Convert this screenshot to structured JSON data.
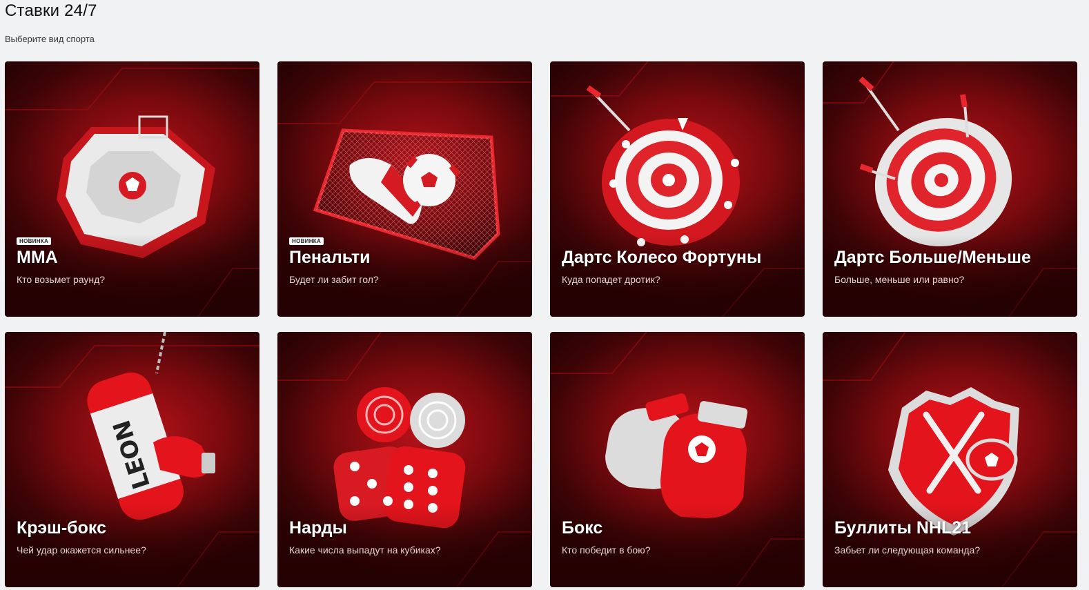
{
  "header": {
    "title": "Ставки 24/7",
    "subtitle": "Выберите вид спорта"
  },
  "colors": {
    "accent": "#e3141c",
    "card_dark": "#2a0204",
    "card_mid": "#7a0a0e",
    "page_bg": "#f1f2f4"
  },
  "cards": [
    {
      "title": "MMA",
      "subtitle": "Кто возьмет раунд?",
      "badge": "НОВИНКА",
      "icon": "octagon-cage-icon"
    },
    {
      "title": "Пенальти",
      "subtitle": "Будет ли забит гол?",
      "badge": "НОВИНКА",
      "icon": "football-goal-icon"
    },
    {
      "title": "Дартс Колесо Фортуны",
      "subtitle": "Куда попадет дротик?",
      "badge": "",
      "icon": "dart-wheel-icon"
    },
    {
      "title": "Дартс Больше/Меньше",
      "subtitle": "Больше, меньше или равно?",
      "badge": "",
      "icon": "dartboard-icon"
    },
    {
      "title": "Крэш-бокс",
      "subtitle": "Чей удар окажется сильнее?",
      "badge": "",
      "icon": "punching-bag-icon"
    },
    {
      "title": "Нарды",
      "subtitle": "Какие числа выпадут на кубиках?",
      "badge": "",
      "icon": "dice-icon"
    },
    {
      "title": "Бокс",
      "subtitle": "Кто победит в бою?",
      "badge": "",
      "icon": "boxing-gloves-icon"
    },
    {
      "title": "Буллиты NHL21",
      "subtitle": "Забьет ли следующая команда?",
      "badge": "",
      "icon": "hockey-shield-icon"
    }
  ]
}
